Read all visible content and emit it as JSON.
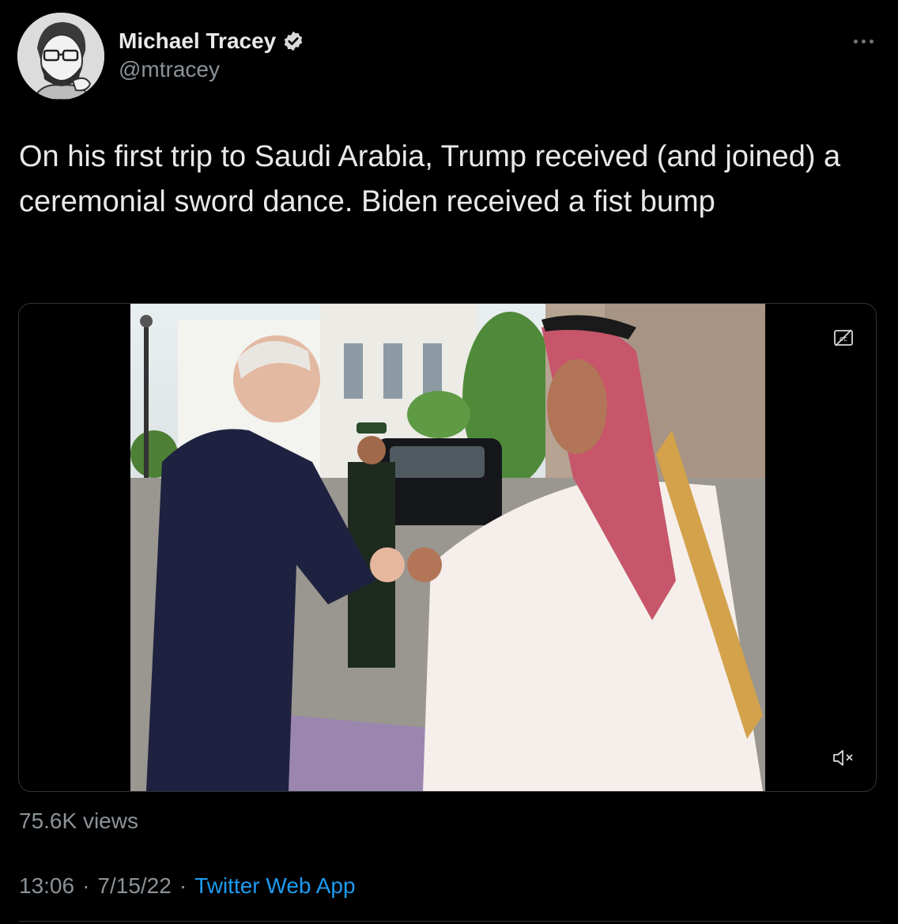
{
  "user": {
    "name": "Michael Tracey",
    "handle": "@mtracey",
    "verified_color": "#d9d9d9"
  },
  "tweet": {
    "text": "On his first trip to Saudi Arabia, Trump received (and joined) a ceremonial sword dance. Biden received a fist bump"
  },
  "media": {
    "type": "video",
    "controls": [
      "cc-icon",
      "mute-icon"
    ]
  },
  "stats": {
    "views": "75.6K views"
  },
  "footer": {
    "time": "13:06",
    "sep1": "·",
    "date": "7/15/22",
    "sep2": "·",
    "source": "Twitter Web App"
  },
  "colors": {
    "background": "#000000",
    "text": "#e7e9ea",
    "secondary": "#8b9298",
    "link": "#1d9bf0"
  }
}
